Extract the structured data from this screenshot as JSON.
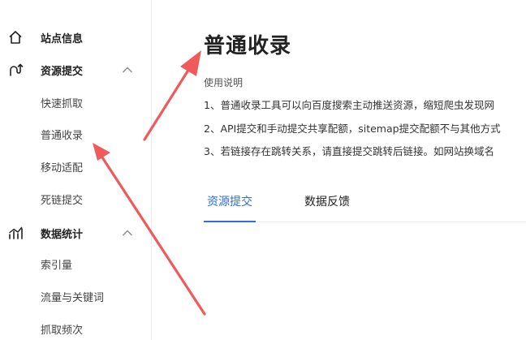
{
  "sidebar": {
    "items": [
      {
        "label": "站点信息",
        "icon": "home-icon"
      },
      {
        "label": "资源提交",
        "icon": "submit-link-icon"
      },
      {
        "label": "快速抓取"
      },
      {
        "label": "普通收录"
      },
      {
        "label": "移动适配"
      },
      {
        "label": "死链提交"
      },
      {
        "label": "数据统计",
        "icon": "stats-icon"
      },
      {
        "label": "索引量"
      },
      {
        "label": "流量与关键词"
      },
      {
        "label": "抓取频次"
      }
    ]
  },
  "main": {
    "title": "普通收录",
    "usage_title": "使用说明",
    "notes": [
      "1、普通收录工具可以向百度搜索主动推送资源，缩短爬虫发现网",
      "2、API提交和手动提交共享配额，sitemap提交配额不与其他方式",
      "3、若链接存在跳转关系，请直接提交跳转后链接。如网站换域名"
    ],
    "tabs": [
      {
        "label": "资源提交",
        "active": true
      },
      {
        "label": "数据反馈",
        "active": false
      }
    ]
  },
  "colors": {
    "accent": "#2f6ee0",
    "annotation_arrow": "#f05a5a"
  }
}
